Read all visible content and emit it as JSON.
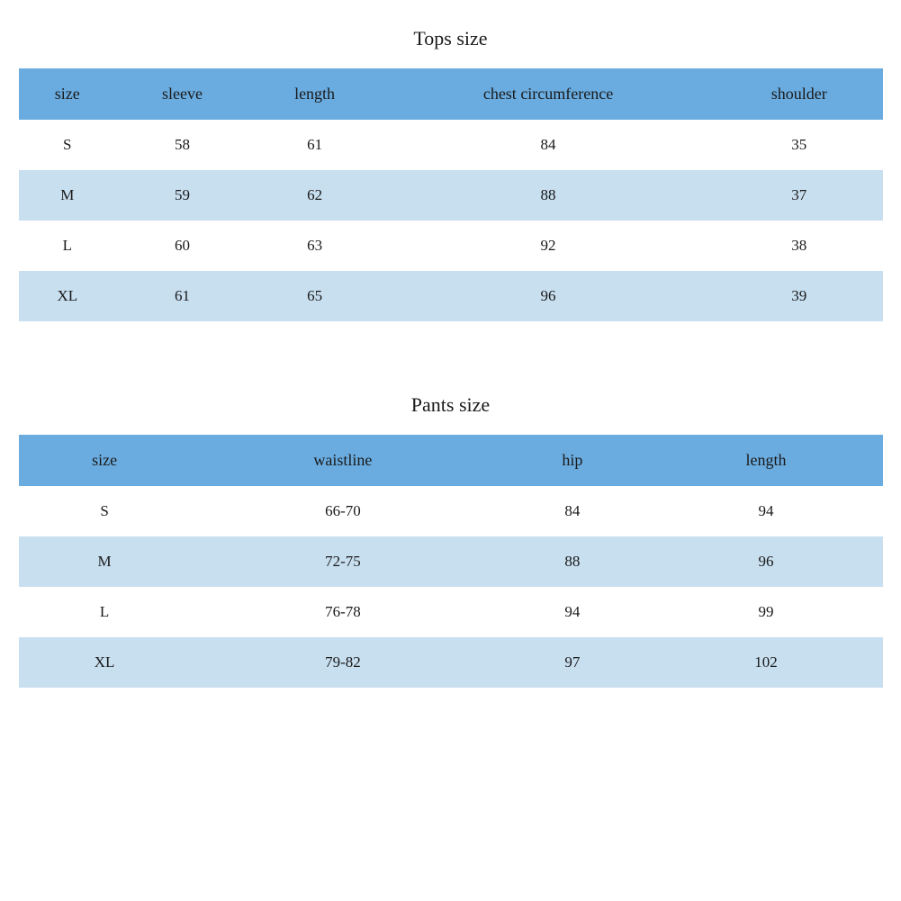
{
  "tops": {
    "title": "Tops size",
    "headers": [
      "size",
      "sleeve",
      "length",
      "chest circumference",
      "shoulder"
    ],
    "rows": [
      [
        "S",
        "58",
        "61",
        "84",
        "35"
      ],
      [
        "M",
        "59",
        "62",
        "88",
        "37"
      ],
      [
        "L",
        "60",
        "63",
        "92",
        "38"
      ],
      [
        "XL",
        "61",
        "65",
        "96",
        "39"
      ]
    ]
  },
  "pants": {
    "title": "Pants size",
    "headers": [
      "size",
      "waistline",
      "hip",
      "length"
    ],
    "rows": [
      [
        "S",
        "66-70",
        "84",
        "94"
      ],
      [
        "M",
        "72-75",
        "88",
        "96"
      ],
      [
        "L",
        "76-78",
        "94",
        "99"
      ],
      [
        "XL",
        "79-82",
        "97",
        "102"
      ]
    ]
  }
}
